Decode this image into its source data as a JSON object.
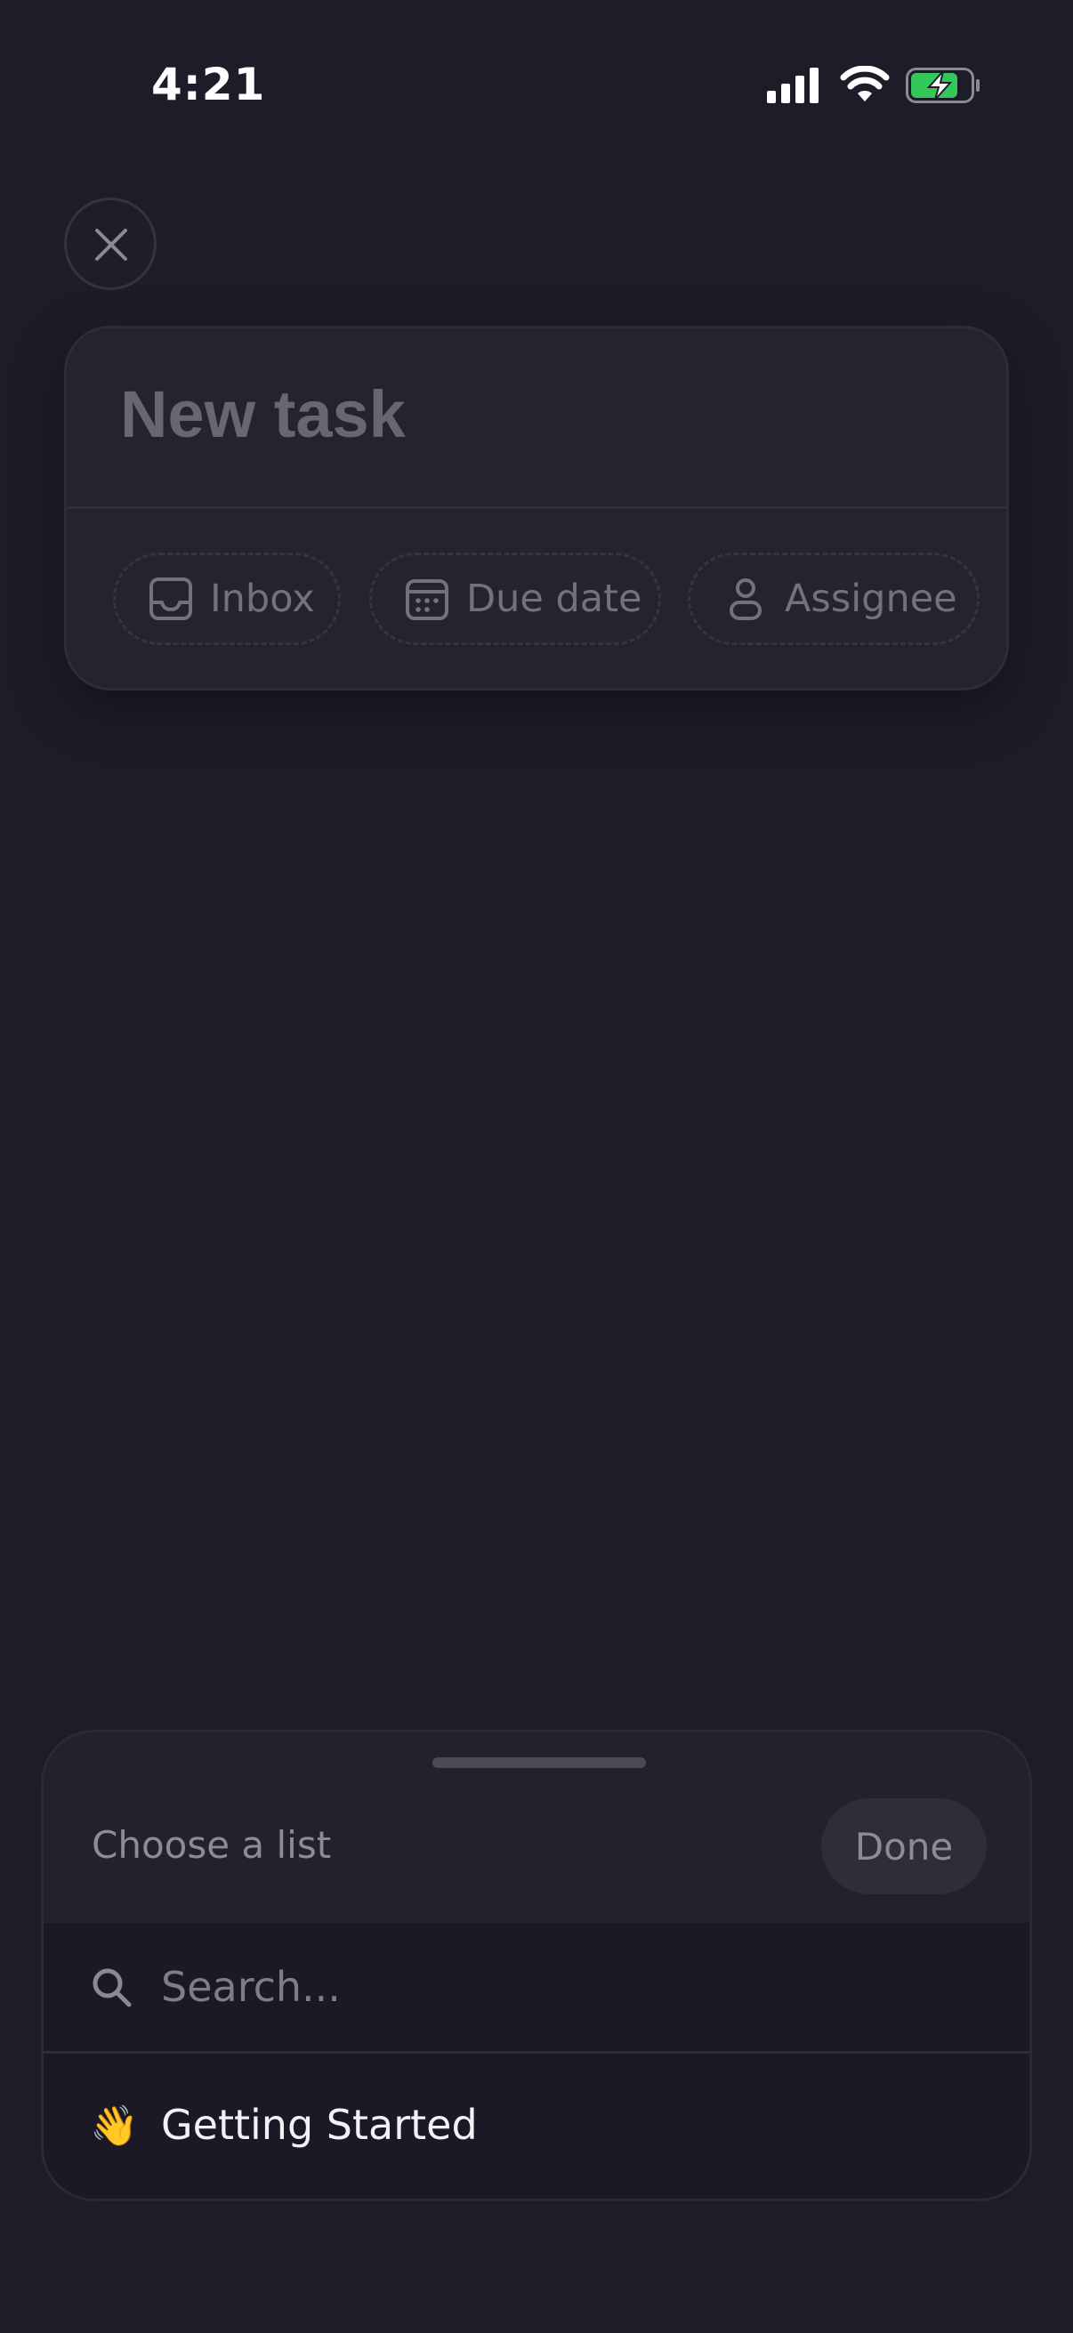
{
  "status_bar": {
    "time": "4:21"
  },
  "close_button": {
    "icon": "close-icon"
  },
  "task_card": {
    "title_placeholder": "New task",
    "chips": [
      {
        "label": "Inbox",
        "icon": "inbox-icon"
      },
      {
        "label": "Due date",
        "icon": "calendar-icon"
      },
      {
        "label": "Assignee",
        "icon": "person-icon"
      }
    ]
  },
  "sheet": {
    "title": "Choose a list",
    "done_label": "Done",
    "search_placeholder": "Search...",
    "lists": [
      {
        "emoji": "👋",
        "label": "Getting Started"
      }
    ]
  },
  "colors": {
    "background": "#1d1c29",
    "card": "#24232f",
    "sheet": "#22212e",
    "battery_green": "#34c759"
  }
}
